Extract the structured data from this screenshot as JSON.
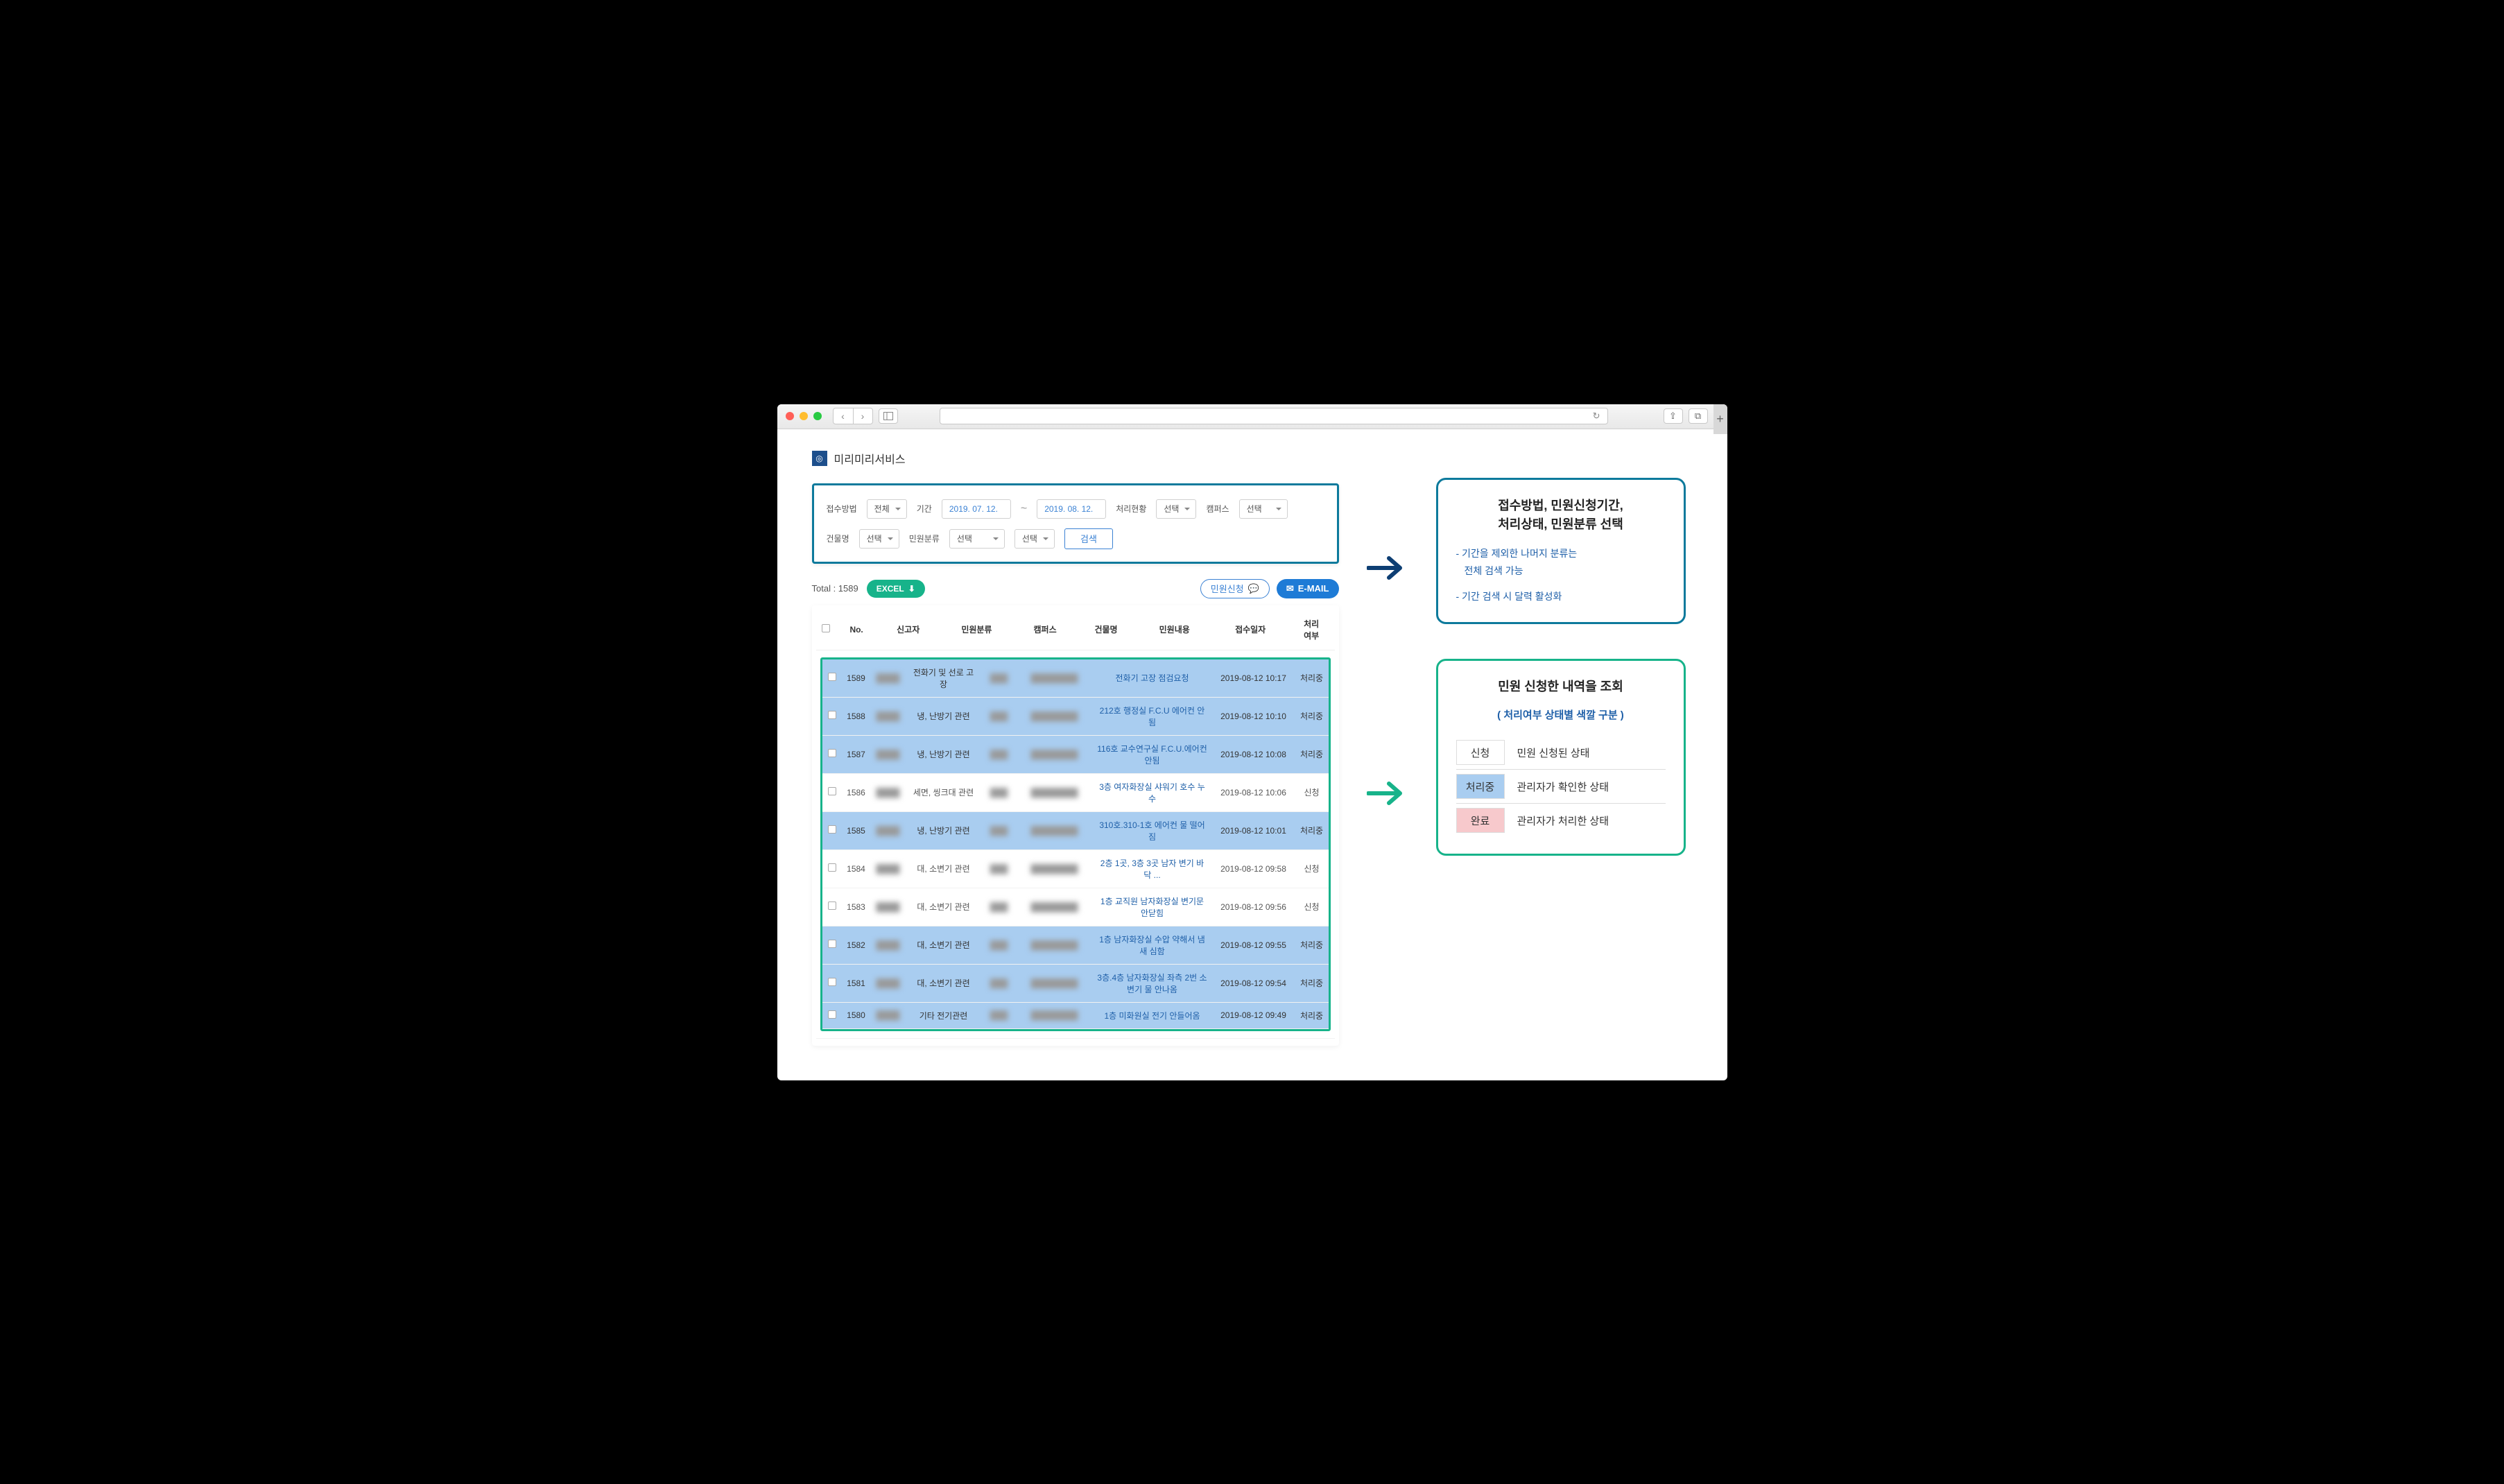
{
  "brand": "미리미리서비스",
  "filters": {
    "method_label": "접수방법",
    "method_value": "전체",
    "period_label": "기간",
    "date_from": "2019. 07. 12.",
    "date_to": "2019. 08. 12.",
    "status_label": "처리현황",
    "status_value": "선택",
    "campus_label": "캠퍼스",
    "campus_value": "선택",
    "building_label": "건물명",
    "building_value": "선택",
    "category_label": "민원분류",
    "category_value": "선택",
    "subcategory_value": "선택",
    "search_button": "검색"
  },
  "toolbar": {
    "total": "Total : 1589",
    "excel": "EXCEL",
    "request": "민원신청",
    "email": "E-MAIL"
  },
  "table": {
    "headers": {
      "no": "No.",
      "reporter": "신고자",
      "category": "민원분류",
      "campus": "캠퍼스",
      "building": "건물명",
      "content": "민원내용",
      "date": "접수일자",
      "status": "처리\n여부"
    },
    "rows": [
      {
        "no": "1589",
        "category": "전화기 및 선로 고장",
        "content": "전화기 고장 점검요청",
        "date": "2019-08-12 10:17",
        "status": "처리중",
        "cls": "processing"
      },
      {
        "no": "1588",
        "category": "냉, 난방기 관련",
        "content": "212호 행정실 F.C.U 에어컨 안됨",
        "date": "2019-08-12 10:10",
        "status": "처리중",
        "cls": "processing"
      },
      {
        "no": "1587",
        "category": "냉, 난방기 관련",
        "content": "116호 교수연구실 F.C.U.에어컨 안됨",
        "date": "2019-08-12 10:08",
        "status": "처리중",
        "cls": "processing"
      },
      {
        "no": "1586",
        "category": "세면, 씽크대 관련",
        "content": "3층 여자화장실 샤워기 호수 누수",
        "date": "2019-08-12 10:06",
        "status": "신청",
        "cls": ""
      },
      {
        "no": "1585",
        "category": "냉, 난방기 관련",
        "content": "310호.310-1호 에어컨 물 떨어짐",
        "date": "2019-08-12 10:01",
        "status": "처리중",
        "cls": "processing"
      },
      {
        "no": "1584",
        "category": "대, 소변기 관련",
        "content": "2층 1곳, 3층 3곳 남자 변기 바닥 ...",
        "date": "2019-08-12 09:58",
        "status": "신청",
        "cls": ""
      },
      {
        "no": "1583",
        "category": "대, 소변기 관련",
        "content": "1층 교직원 남자화장실 변기문 안닫힘",
        "date": "2019-08-12 09:56",
        "status": "신청",
        "cls": ""
      },
      {
        "no": "1582",
        "category": "대, 소변기 관련",
        "content": "1층 남자화장실 수압 약해서 냄새 심함",
        "date": "2019-08-12 09:55",
        "status": "처리중",
        "cls": "processing"
      },
      {
        "no": "1581",
        "category": "대, 소변기 관련",
        "content": "3층.4층 남자화장실 좌측 2번 소변기 물 안나옴",
        "date": "2019-08-12 09:54",
        "status": "처리중",
        "cls": "processing"
      },
      {
        "no": "1580",
        "category": "기타 전기관련",
        "content": "1층 미화원실 전기 안들어옴",
        "date": "2019-08-12 09:49",
        "status": "처리중",
        "cls": "processing"
      }
    ]
  },
  "callout1": {
    "title1": "접수방법, 민원신청기간,",
    "title2": "처리상태, 민원분류 선택",
    "bullet1": "- 기간을 제외한 나머지 분류는",
    "bullet1b": "  전체 검색 가능",
    "bullet2": "- 기간 검색 시 달력 활성화"
  },
  "callout2": {
    "title": "민원 신청한 내역을 조회",
    "sub": "( 처리여부 상태별 색깔 구분 )",
    "legend": [
      {
        "badge": "신청",
        "desc": "민원 신청된 상태"
      },
      {
        "badge": "처리중",
        "desc": "관리자가 확인한 상태"
      },
      {
        "badge": "완료",
        "desc": "관리자가 처리한 상태"
      }
    ]
  }
}
